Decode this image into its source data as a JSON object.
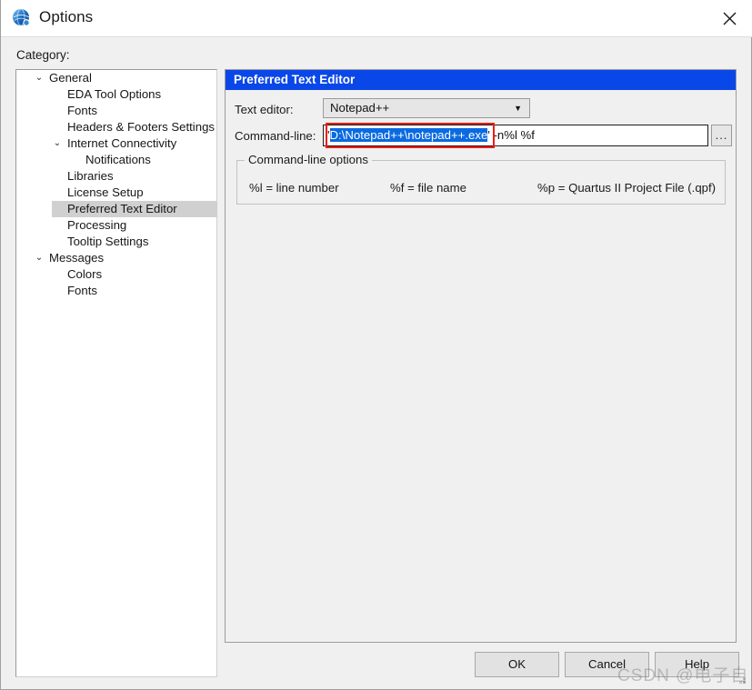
{
  "window": {
    "title": "Options",
    "icon": "quartus-globe-icon",
    "close_icon": "close-icon",
    "resize_grip_icon": "resize-grip-icon",
    "accent_color": "#0a47e8",
    "selection_color": "#d0d0d0",
    "text_selection_color": "#0a6ae0",
    "annotation_color": "#ee1c12"
  },
  "category": {
    "label": "Category:",
    "items": [
      {
        "label": "General",
        "level": 0,
        "expander": "chevron-down-icon",
        "selected": false
      },
      {
        "label": "EDA Tool Options",
        "level": 1,
        "expander": "",
        "selected": false
      },
      {
        "label": "Fonts",
        "level": 1,
        "expander": "",
        "selected": false
      },
      {
        "label": "Headers & Footers Settings",
        "level": 1,
        "expander": "",
        "selected": false
      },
      {
        "label": "Internet Connectivity",
        "level": 1,
        "expander": "chevron-down-icon",
        "selected": false
      },
      {
        "label": "Notifications",
        "level": 2,
        "expander": "",
        "selected": false
      },
      {
        "label": "Libraries",
        "level": 1,
        "expander": "",
        "selected": false
      },
      {
        "label": "License Setup",
        "level": 1,
        "expander": "",
        "selected": false
      },
      {
        "label": "Preferred Text Editor",
        "level": 1,
        "expander": "",
        "selected": true
      },
      {
        "label": "Processing",
        "level": 1,
        "expander": "",
        "selected": false
      },
      {
        "label": "Tooltip Settings",
        "level": 1,
        "expander": "",
        "selected": false
      },
      {
        "label": "Messages",
        "level": 0,
        "expander": "chevron-down-icon",
        "selected": false
      },
      {
        "label": "Colors",
        "level": 1,
        "expander": "",
        "selected": false
      },
      {
        "label": "Fonts",
        "level": 1,
        "expander": "",
        "selected": false
      }
    ]
  },
  "panel": {
    "header": "Preferred Text Editor",
    "text_editor": {
      "label": "Text editor:",
      "value": "Notepad++",
      "arrow_icon": "chevron-down-icon"
    },
    "command_line": {
      "label": "Command-line:",
      "prefix": "'",
      "selected_path": "D:\\Notepad++\\notepad++.exe",
      "suffix": "' -n%l %f",
      "full_value": "'D:\\Notepad++\\notepad++.exe' -n%l %f",
      "browse_label": "...",
      "browse_icon": "ellipsis-icon"
    },
    "options_group": {
      "title": "Command-line options",
      "entries": [
        "%l = line number",
        "%f = file name",
        "%p = Quartus II Project File (.qpf)"
      ]
    }
  },
  "buttons": {
    "ok": "OK",
    "cancel": "Cancel",
    "help": "Help"
  },
  "watermark": {
    "text": "CSDN @电子自"
  }
}
